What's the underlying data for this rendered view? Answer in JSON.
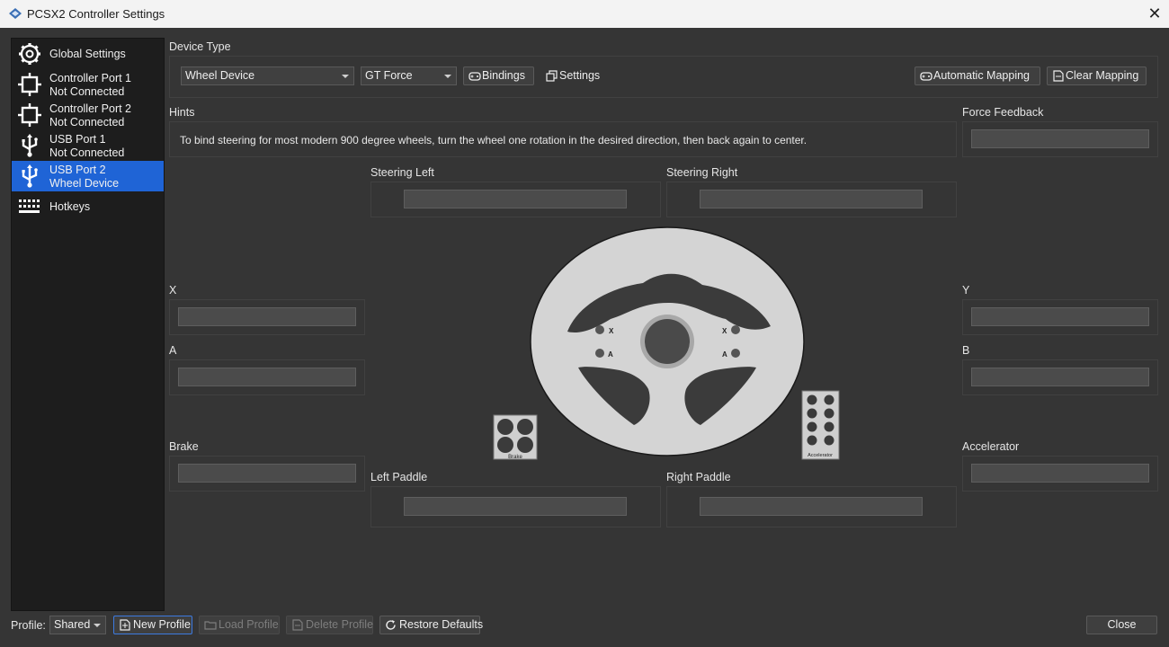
{
  "window": {
    "title": "PCSX2 Controller Settings",
    "close_glyph": "✕"
  },
  "sidebar": {
    "items": [
      {
        "line1": "Global Settings",
        "line2": "",
        "icon": "gear-icon"
      },
      {
        "line1": "Controller Port 1",
        "line2": "Not Connected",
        "icon": "controller-port-icon"
      },
      {
        "line1": "Controller Port 2",
        "line2": "Not Connected",
        "icon": "controller-port-icon"
      },
      {
        "line1": "USB Port 1",
        "line2": "Not Connected",
        "icon": "usb-icon"
      },
      {
        "line1": "USB Port 2",
        "line2": "Wheel Device",
        "icon": "usb-icon",
        "active": true
      },
      {
        "line1": "Hotkeys",
        "line2": "",
        "icon": "keyboard-icon"
      }
    ]
  },
  "device": {
    "label": "Device Type",
    "type_value": "Wheel Device",
    "subtype_value": "GT Force",
    "bindings_label": "Bindings",
    "settings_label": "Settings",
    "auto_mapping_label": "Automatic Mapping",
    "clear_mapping_label": "Clear Mapping"
  },
  "hints": {
    "label": "Hints",
    "text": "To bind steering for most modern 900 degree wheels, turn the wheel one rotation in the desired direction, then back again to center."
  },
  "bindings": {
    "force_feedback": "Force Feedback",
    "steering_left": "Steering Left",
    "steering_right": "Steering Right",
    "x": "X",
    "y": "Y",
    "a": "A",
    "b": "B",
    "brake": "Brake",
    "accelerator": "Accelerator",
    "left_paddle": "Left Paddle",
    "right_paddle": "Right Paddle"
  },
  "wheel_art": {
    "brake_caption": "Brake",
    "accelerator_caption": "Accelerator",
    "x_mark": "X",
    "a_mark": "A"
  },
  "footer": {
    "profile_label": "Profile:",
    "profile_value": "Shared",
    "new_profile": "New Profile",
    "load_profile": "Load Profile",
    "delete_profile": "Delete Profile",
    "restore_defaults": "Restore Defaults",
    "close": "Close"
  },
  "colors": {
    "accent": "#1f64d6",
    "background": "#353535",
    "sidebar": "#1d1d1d",
    "wheel": "#d4d4d4"
  }
}
